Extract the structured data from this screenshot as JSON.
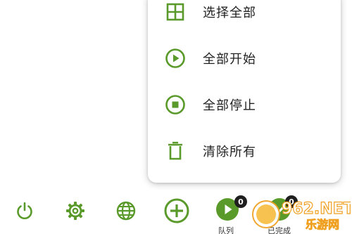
{
  "accent_color": "#5a9a2b",
  "menu": {
    "items": [
      {
        "label": "选择全部",
        "icon": "select-all-grid-icon"
      },
      {
        "label": "全部开始",
        "icon": "play-circle-icon"
      },
      {
        "label": "全部停止",
        "icon": "stop-circle-icon"
      },
      {
        "label": "清除所有",
        "icon": "trash-icon"
      }
    ]
  },
  "bottom_bar": {
    "power": {
      "icon": "power-icon"
    },
    "settings": {
      "icon": "gear-icon"
    },
    "browser": {
      "icon": "globe-icon"
    },
    "add": {
      "icon": "add-circle-icon"
    },
    "queue": {
      "icon": "play-filled-icon",
      "label": "队列",
      "badge": "0"
    },
    "completed": {
      "icon": "check-icon",
      "label": "已完成",
      "badge": "0"
    }
  },
  "watermark": {
    "brand": "962.NET",
    "text": "乐游网"
  }
}
